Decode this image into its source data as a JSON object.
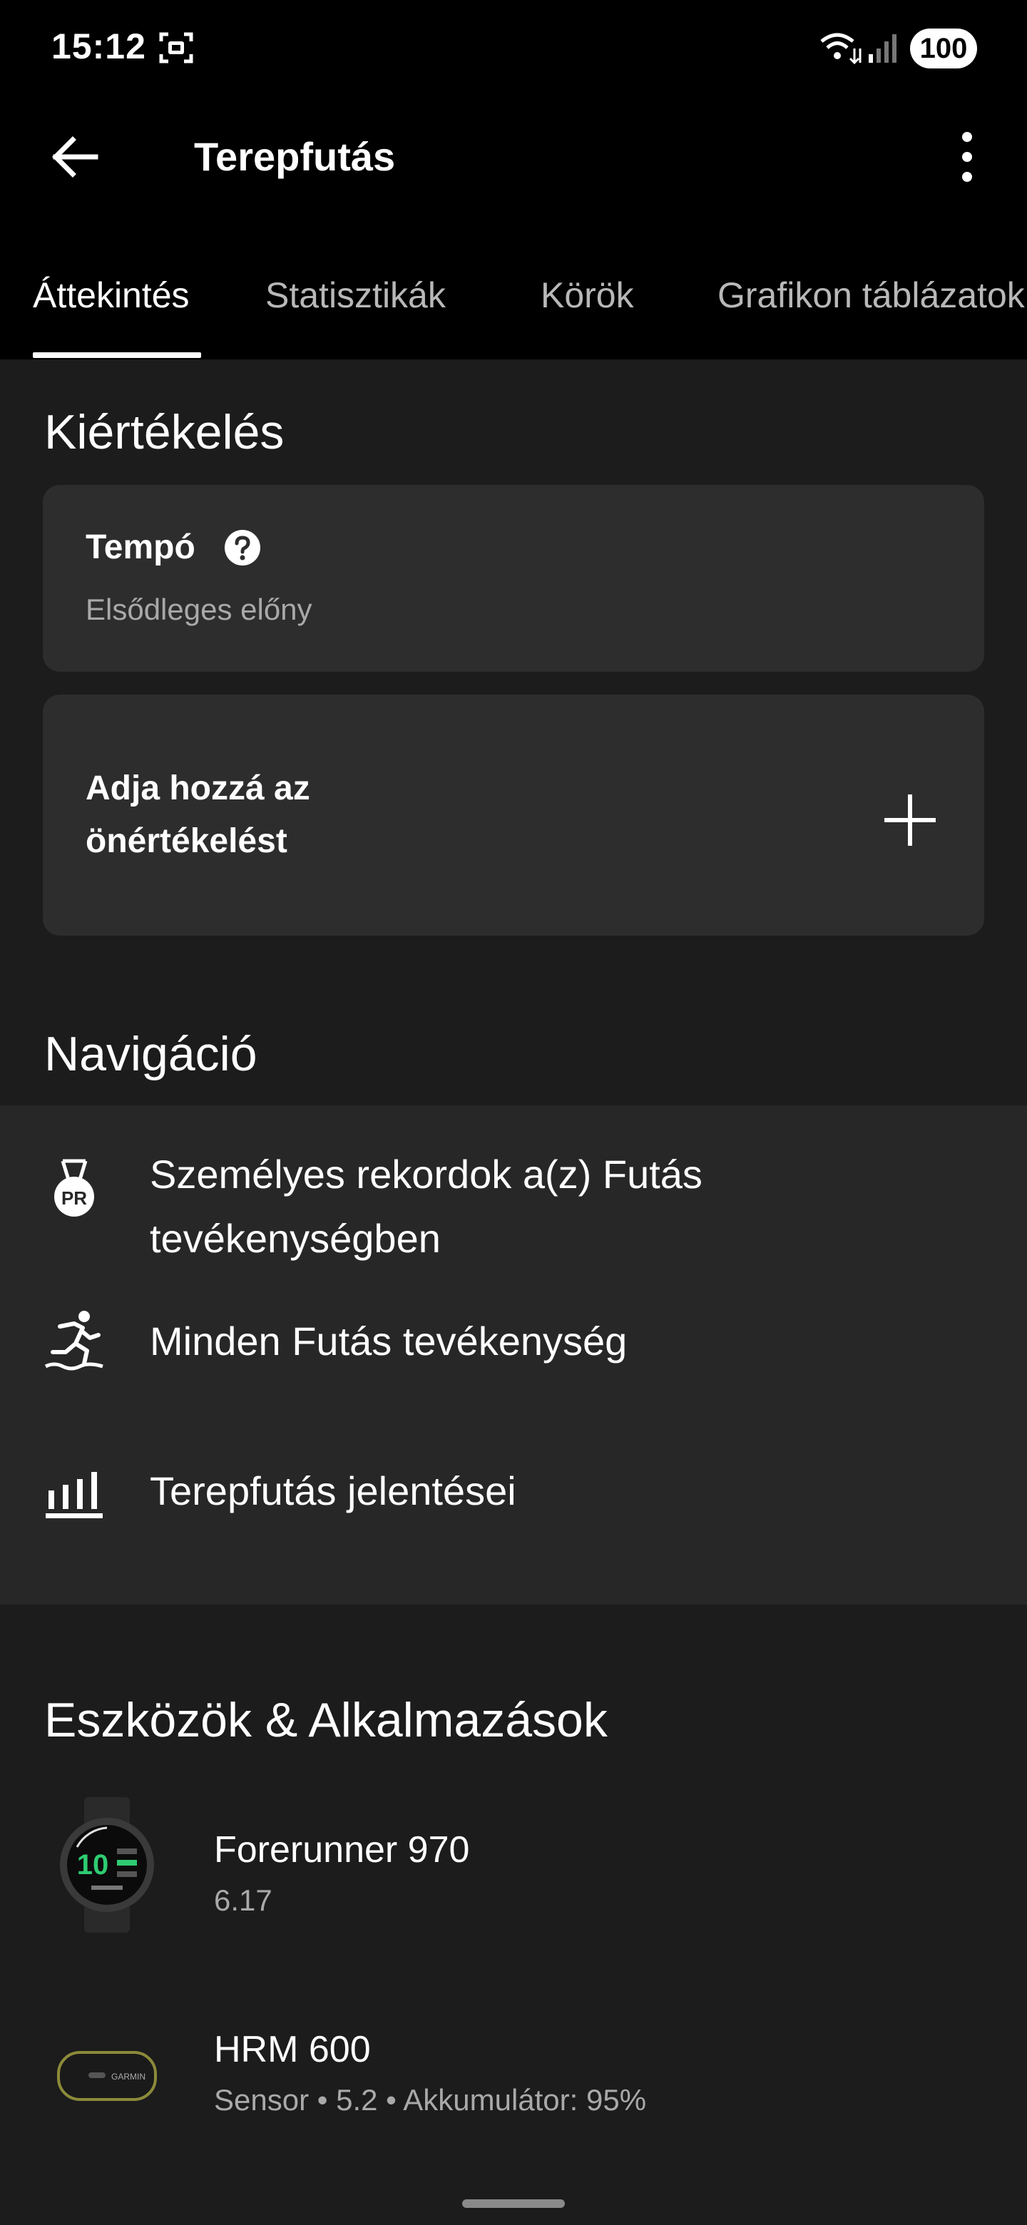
{
  "status_bar": {
    "time": "15:12",
    "battery": "100"
  },
  "app_bar": {
    "title": "Terepfutás"
  },
  "tabs": [
    {
      "label": "Áttekintés",
      "active": true
    },
    {
      "label": "Statisztikák",
      "active": false
    },
    {
      "label": "Körök",
      "active": false
    },
    {
      "label": "Grafikon táblázatok",
      "active": false
    }
  ],
  "evaluation": {
    "heading": "Kiértékelés",
    "tempo_card": {
      "title": "Tempó",
      "subtitle": "Elsődleges előny"
    },
    "self_eval_card": {
      "line1": "Adja hozzá az",
      "line2": "önértékelést"
    }
  },
  "navigation": {
    "heading": "Navigáció",
    "items": [
      {
        "line1": "Személyes rekordok a(z) Futás",
        "line2": "tevékenységben",
        "icon": "pr-medal-icon",
        "pr_text": "PR"
      },
      {
        "label": "Minden Futás tevékenység",
        "icon": "running-icon"
      },
      {
        "label": "Terepfutás jelentései",
        "icon": "bar-chart-icon"
      }
    ]
  },
  "devices": {
    "heading": "Eszközök & Alkalmazások",
    "items": [
      {
        "name": "Forerunner 970",
        "detail": "6.17",
        "watch_number": "10"
      },
      {
        "name": "HRM 600",
        "detail": "Sensor • 5.2 • Akkumulátor: 95%",
        "brand": "GARMIN"
      }
    ]
  },
  "colors": {
    "background": "#1c1c1c",
    "card": "#2d2d2d",
    "bar": "#000000",
    "accent_green": "#2ecc71"
  }
}
